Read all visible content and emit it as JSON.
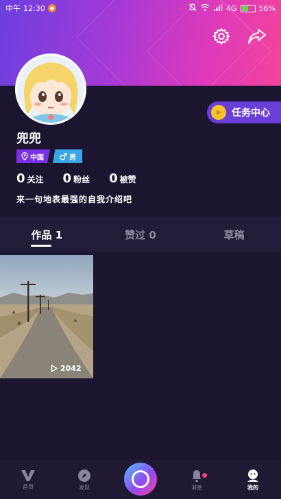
{
  "status_bar": {
    "carrier": "中午",
    "time": "12:30",
    "network": "4G",
    "battery": "56%"
  },
  "profile": {
    "username": "兜兜",
    "location_tag": "中国",
    "gender_tag": "男",
    "stats": [
      {
        "num": "0",
        "label": "关注"
      },
      {
        "num": "0",
        "label": "粉丝"
      },
      {
        "num": "0",
        "label": "被赞"
      }
    ],
    "bio": "来一句地表最强的自我介绍吧"
  },
  "task_center": {
    "label": "任务中心"
  },
  "tabs": [
    {
      "label": "作品 1"
    },
    {
      "label": "赞过 0"
    },
    {
      "label": "草稿"
    }
  ],
  "videos": [
    {
      "plays": "2042"
    }
  ],
  "bottom_nav": [
    {
      "label": "首页",
      "icon": "v-logo-icon"
    },
    {
      "label": "发现",
      "icon": "compass-icon"
    },
    {
      "label": "",
      "icon": "record-icon"
    },
    {
      "label": "消息",
      "icon": "bell-icon"
    },
    {
      "label": "我的",
      "icon": "profile-icon"
    }
  ],
  "colors": {
    "accent_purple": "#6a3fd8",
    "accent_pink": "#f2449a",
    "background": "#1b1530"
  }
}
